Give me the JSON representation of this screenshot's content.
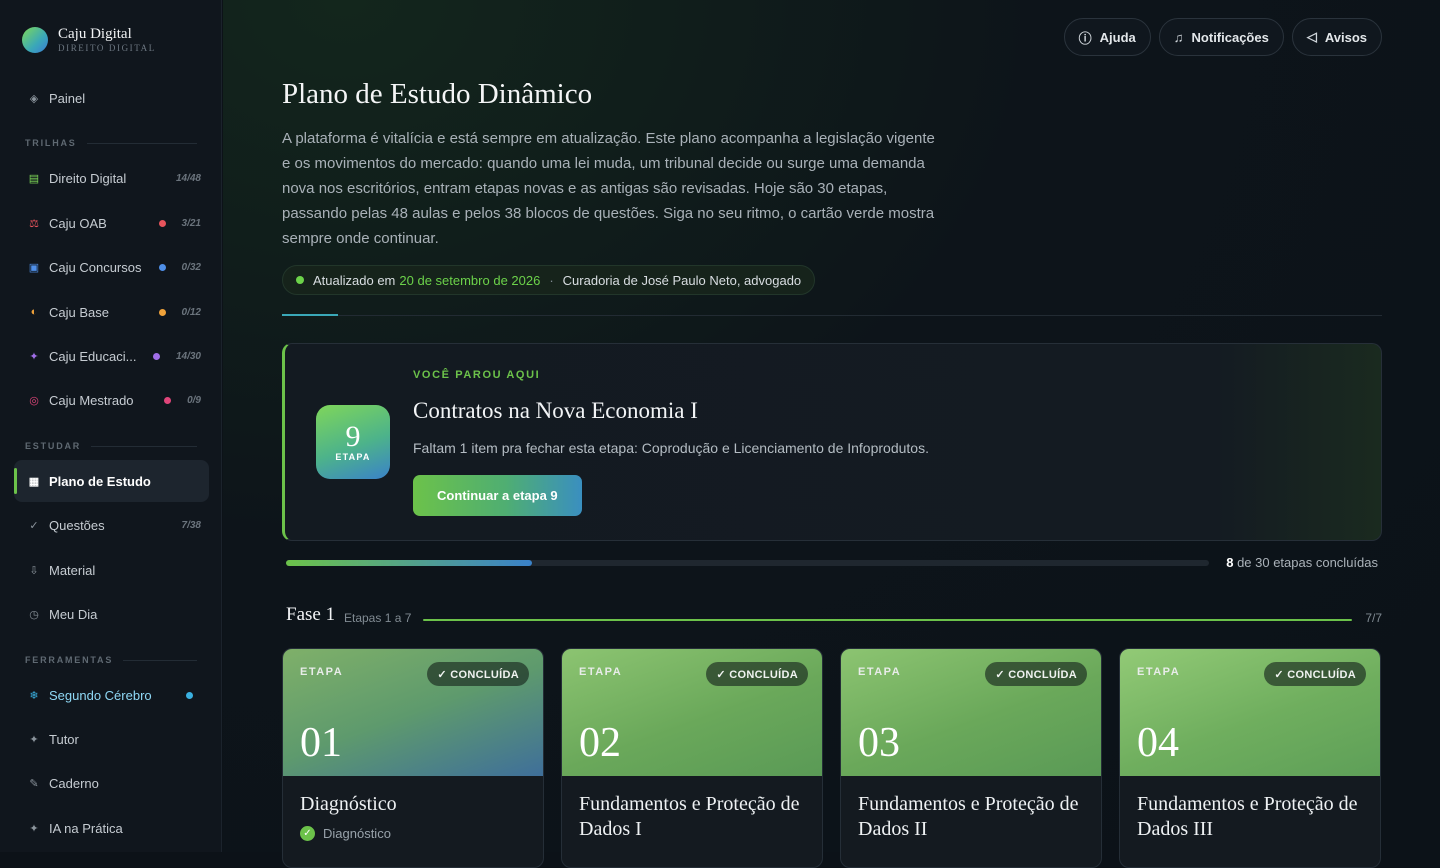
{
  "brand": {
    "title": "Caju Digital",
    "subtitle": "DIREITO DIGITAL"
  },
  "nav": {
    "painel": {
      "icon": "diamond-icon",
      "label": "Painel"
    },
    "section_trilhas": "TRILHAS",
    "trilhas": [
      {
        "icon": "book-icon",
        "label": "Direito Digital",
        "count": "14/48",
        "color": "#7ed957"
      },
      {
        "icon": "scales-icon",
        "label": "Caju OAB",
        "count": "3/21",
        "color": "#e8545c"
      },
      {
        "icon": "building-icon",
        "label": "Caju Concursos",
        "count": "0/32",
        "color": "#4f8fe8"
      },
      {
        "icon": "half-circle-icon",
        "label": "Caju Base",
        "count": "0/12",
        "color": "#f0a23a"
      },
      {
        "icon": "sparkle-icon",
        "label": "Caju Educaci...",
        "count": "14/30",
        "color": "#a06ee8"
      },
      {
        "icon": "target-icon",
        "label": "Caju Mestrado",
        "count": "0/9",
        "color": "#e0457a"
      }
    ],
    "section_estudar": "ESTUDAR",
    "estudar": [
      {
        "icon": "grid-icon",
        "label": "Plano de Estudo",
        "count": ""
      },
      {
        "icon": "check-icon",
        "label": "Questões",
        "count": "7/38"
      },
      {
        "icon": "download-icon",
        "label": "Material",
        "count": ""
      },
      {
        "icon": "clock-icon",
        "label": "Meu Dia",
        "count": ""
      }
    ],
    "section_ferramentas": "FERRAMENTAS",
    "ferramentas": [
      {
        "icon": "snowflake-icon",
        "label": "Segundo Cérebro",
        "color": "#3ab0e0"
      },
      {
        "icon": "sparkle-icon",
        "label": "Tutor"
      },
      {
        "icon": "pencil-icon",
        "label": "Caderno"
      },
      {
        "icon": "sparkle-icon",
        "label": "IA na Prática"
      }
    ]
  },
  "topbar": {
    "help": "Ajuda",
    "notifications": "Notificações",
    "notices": "Avisos"
  },
  "page": {
    "title": "Plano de Estudo Dinâmico",
    "intro": "A plataforma é vitalícia e está sempre em atualização. Este plano acompanha a legislação vigente e os movimentos do mercado: quando uma lei muda, um tribunal decide ou surge uma demanda nova nos escritórios, entram etapas novas e as antigas são revisadas. Hoje são 30 etapas, passando pelas 48 aulas e pelos 38 blocos de questões. Siga no seu ritmo, o cartão verde mostra sempre onde continuar.",
    "updated_prefix": "Atualizado em",
    "updated_date": "20 de setembro de 2026",
    "separator": "·",
    "curator": "Curadoria de José Paulo Neto, advogado"
  },
  "resume": {
    "kicker": "VOCÊ PAROU AQUI",
    "badge_number": "9",
    "badge_label": "ETAPA",
    "title": "Contratos na Nova Economia I",
    "description": "Faltam 1 item pra fechar esta etapa: Coprodução e Licenciamento de Infoprodutos.",
    "button": "Continuar a etapa 9"
  },
  "progress": {
    "completed": "8",
    "suffix": "de 30 etapas concluídas",
    "fraction": 0.2667
  },
  "phase": {
    "title": "Fase 1",
    "subtitle": "Etapas 1 a 7",
    "count": "7/7",
    "fraction": 1.0
  },
  "cards": [
    {
      "kicker": "ETAPA",
      "status": "✓ CONCLUÍDA",
      "number": "01",
      "title": "Diagnóstico",
      "tag": "Diagnóstico"
    },
    {
      "kicker": "ETAPA",
      "status": "✓ CONCLUÍDA",
      "number": "02",
      "title": "Fundamentos e Proteção de Dados I",
      "tag": ""
    },
    {
      "kicker": "ETAPA",
      "status": "✓ CONCLUÍDA",
      "number": "03",
      "title": "Fundamentos e Proteção de Dados II",
      "tag": ""
    },
    {
      "kicker": "ETAPA",
      "status": "✓ CONCLUÍDA",
      "number": "04",
      "title": "Fundamentos e Proteção de Dados III",
      "tag": ""
    }
  ]
}
